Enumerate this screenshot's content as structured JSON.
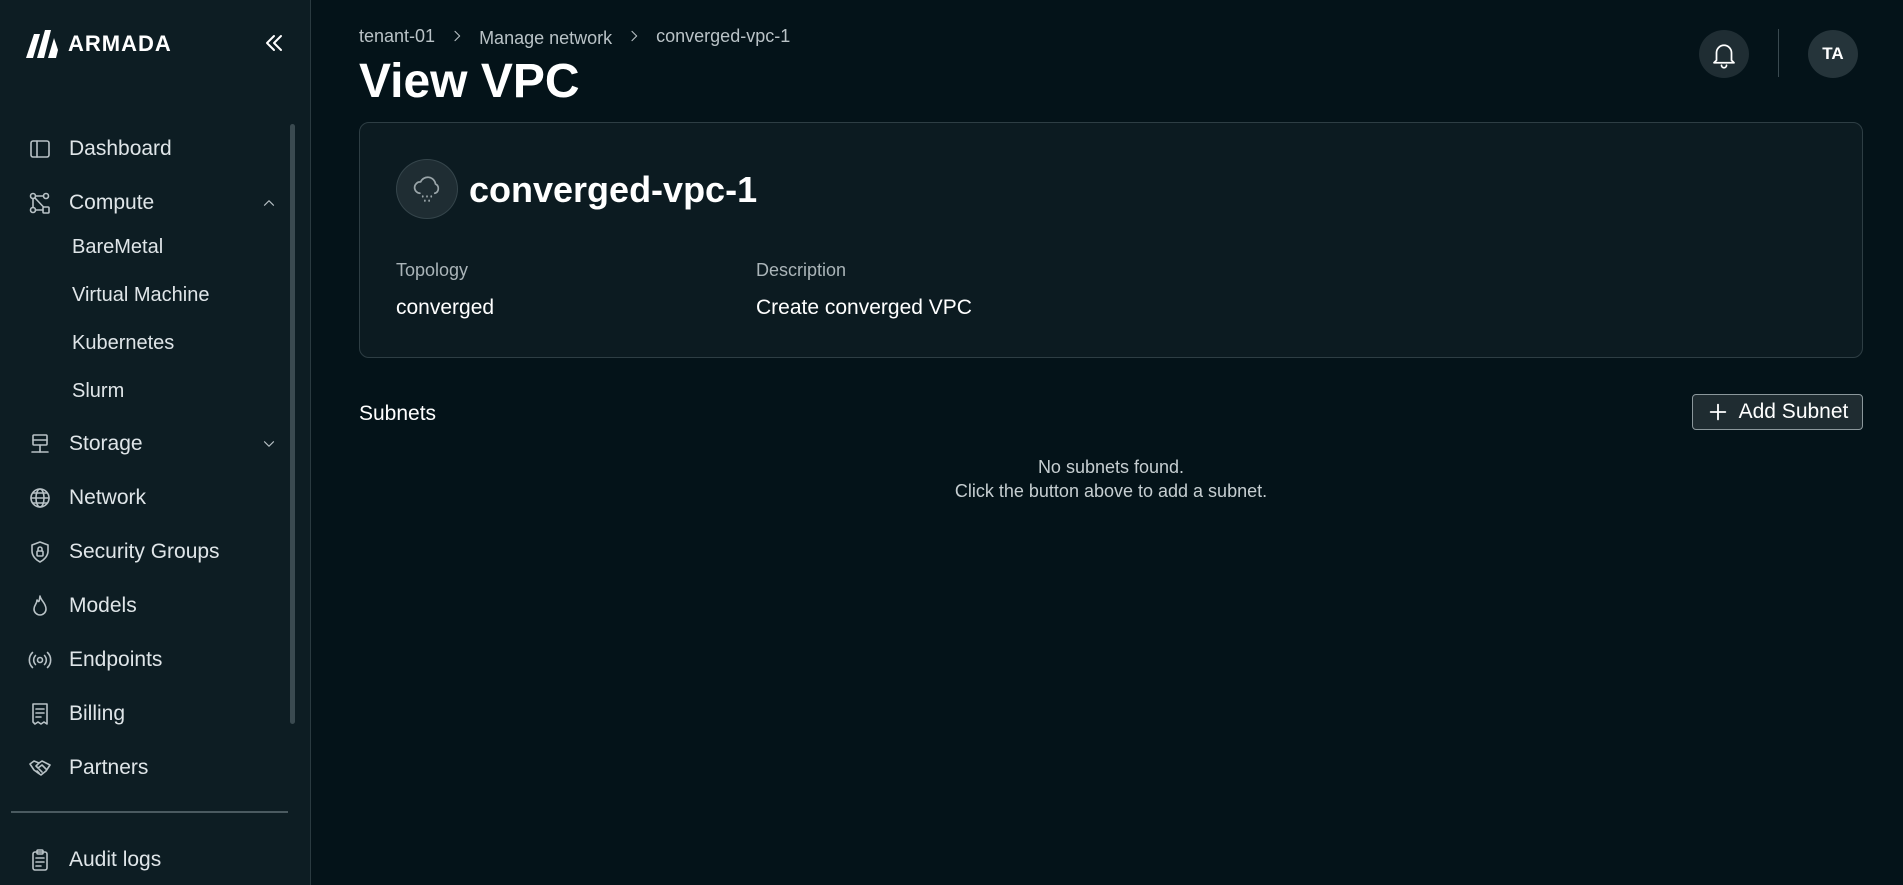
{
  "brand": {
    "name": "ARMADA"
  },
  "sidebar": {
    "items": [
      {
        "label": "Dashboard",
        "icon": "dashboard-icon"
      },
      {
        "label": "Compute",
        "icon": "compute-icon",
        "expanded": true,
        "children": [
          {
            "label": "BareMetal"
          },
          {
            "label": "Virtual Machine"
          },
          {
            "label": "Kubernetes"
          },
          {
            "label": "Slurm"
          }
        ]
      },
      {
        "label": "Storage",
        "icon": "storage-icon",
        "expanded": false
      },
      {
        "label": "Network",
        "icon": "globe-icon"
      },
      {
        "label": "Security Groups",
        "icon": "shield-lock-icon"
      },
      {
        "label": "Models",
        "icon": "flame-icon"
      },
      {
        "label": "Endpoints",
        "icon": "broadcast-icon"
      },
      {
        "label": "Billing",
        "icon": "receipt-icon"
      },
      {
        "label": "Partners",
        "icon": "handshake-icon"
      }
    ],
    "footer_items": [
      {
        "label": "Audit logs",
        "icon": "clipboard-icon"
      }
    ]
  },
  "breadcrumb": [
    "tenant-01",
    "Manage network",
    "converged-vpc-1"
  ],
  "header": {
    "title": "View VPC",
    "avatar_initials": "TA"
  },
  "vpc": {
    "name": "converged-vpc-1",
    "topology_label": "Topology",
    "topology_value": "converged",
    "description_label": "Description",
    "description_value": "Create converged VPC"
  },
  "subnets": {
    "title": "Subnets",
    "add_button_label": "Add Subnet",
    "empty_line1": "No subnets found.",
    "empty_line2": "Click the button above to add a subnet."
  },
  "colors": {
    "background": "#041319",
    "sidebar": "#0d1d23",
    "card": "#0c1b21",
    "text": "#ffffff",
    "muted": "#aab4b8"
  }
}
